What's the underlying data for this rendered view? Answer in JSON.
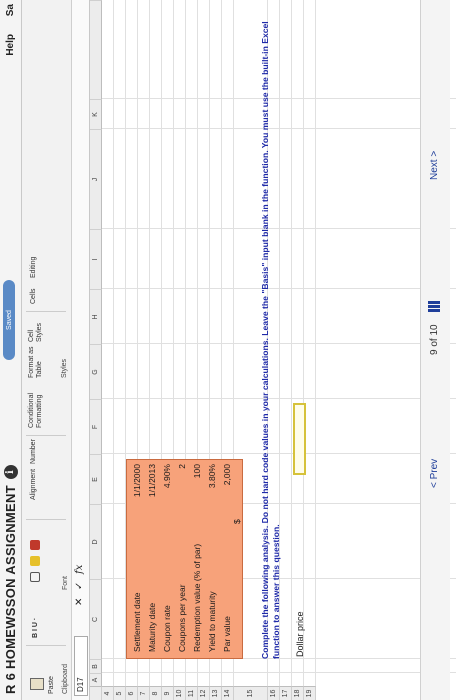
{
  "header": {
    "title": "R 6 HOMEWSSON ASSIGNMENT",
    "info_icon": "i",
    "saved": "Saved",
    "help": "Help",
    "save": "Sa"
  },
  "ribbon": {
    "paste": "Paste",
    "clipboard": "Clipboard",
    "font_buttons": "B  I  U  ·",
    "font_label": "Font",
    "alignment": "Alignment",
    "number": "Number",
    "conditional_formatting": "Conditional Formatting",
    "format_as_table": "Format as Table",
    "cell_styles": "Cell Styles",
    "styles_label": "Styles",
    "cells": "Cells",
    "editing": "Editing"
  },
  "formula_bar": {
    "name_box": "D17",
    "cancel": "✕",
    "enter": "✓",
    "fx": "fx",
    "contents": ""
  },
  "columns": [
    "A",
    "B",
    "C",
    "D",
    "E",
    "F",
    "G",
    "H",
    "I",
    "J",
    "K"
  ],
  "rows": [
    "4",
    "5",
    "6",
    "7",
    "8",
    "9",
    "10",
    "11",
    "12",
    "13",
    "14",
    "15",
    "16",
    "17",
    "18",
    "19"
  ],
  "inputs": [
    {
      "label": "Settlement date",
      "value": "1/1/2000"
    },
    {
      "label": "Maturity date",
      "value": "1/1/2013"
    },
    {
      "label": "Coupon rate",
      "value": "4.90%"
    },
    {
      "label": "Coupons per year",
      "value": "2"
    },
    {
      "label": "Redemption value (% of par)",
      "value": "100"
    },
    {
      "label": "Yield to maturity",
      "value": "3.80%"
    },
    {
      "label": "Par value",
      "value": "2,000"
    }
  ],
  "par_currency": "$",
  "instructions": "Complete the following analysis. Do not hard code values in your calculations. Leave the \"Basis\" input blank in the function. You must use the built-in Excel function to answer this question.",
  "dollar_price_label": "Dollar price",
  "pager": {
    "prev": "< Prev",
    "count": "9 of 10",
    "next": "Next >"
  },
  "colors": {
    "input_box": "#f7a27a",
    "instructions": "#1f2aa8",
    "answer_border": "#d6c23a",
    "nav": "#1f3e9a"
  }
}
